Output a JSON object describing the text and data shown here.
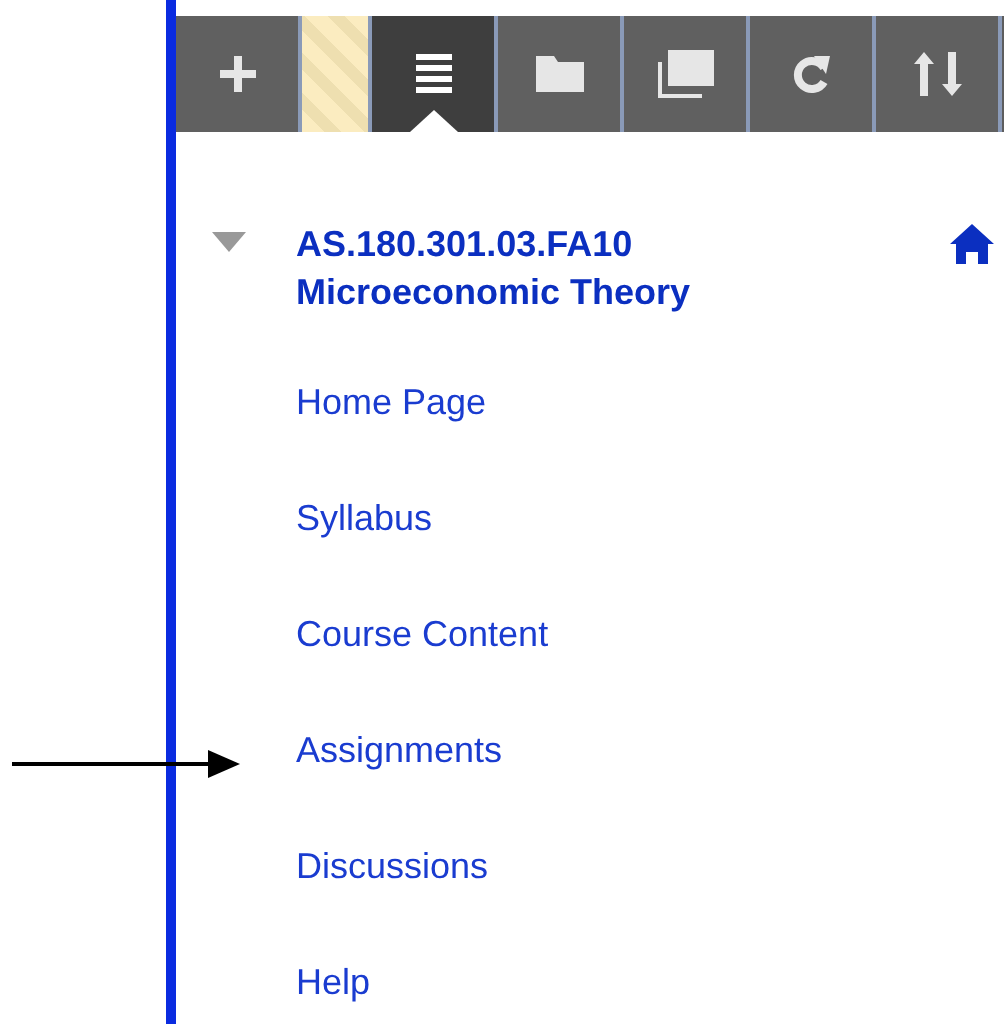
{
  "toolbar": [
    {
      "kind": "add",
      "selected": false
    },
    {
      "kind": "handle",
      "selected": false
    },
    {
      "kind": "list",
      "selected": true
    },
    {
      "kind": "folder",
      "selected": false
    },
    {
      "kind": "windows",
      "selected": false
    },
    {
      "kind": "refresh",
      "selected": false
    },
    {
      "kind": "sort",
      "selected": false
    }
  ],
  "course": {
    "expanded": true,
    "code": "AS.180.301.03.FA10",
    "name": "Microeconomic Theory"
  },
  "menu": [
    {
      "label": "Home Page"
    },
    {
      "label": "Syllabus"
    },
    {
      "label": "Course Content"
    },
    {
      "label": "Assignments"
    },
    {
      "label": "Discussions"
    },
    {
      "label": "Help"
    }
  ]
}
